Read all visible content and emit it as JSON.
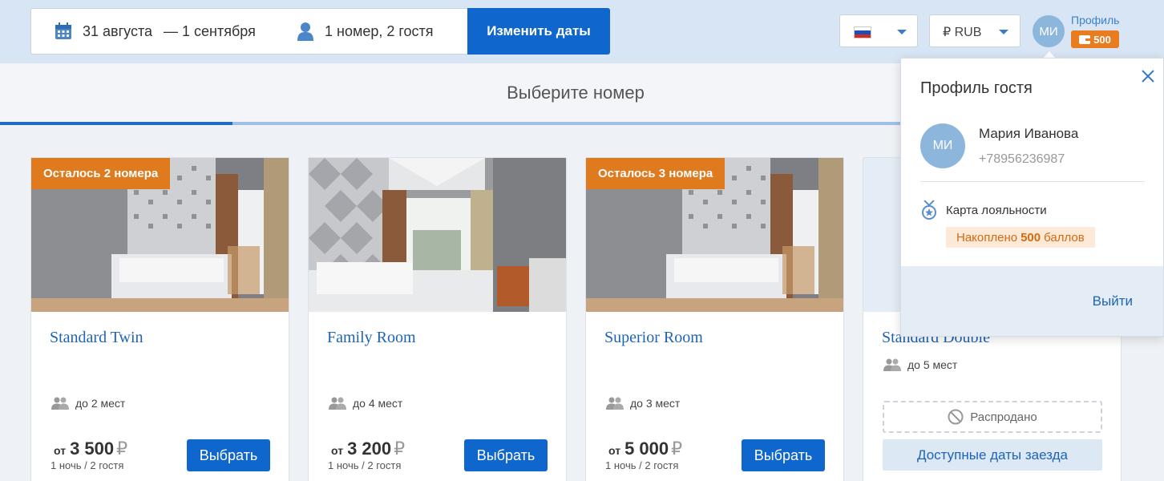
{
  "search": {
    "dates": "31 августа",
    "dates_end": "— 1 сентября",
    "guests": "1 номер, 2 гостя",
    "change_button": "Изменить даты"
  },
  "header": {
    "currency": "₽ RUB",
    "avatar_initials": "МИ",
    "profile_link": "Профиль",
    "points": "500"
  },
  "page": {
    "title": "Выберите номер",
    "progress": 0.2
  },
  "rooms": [
    {
      "badge": "Осталось 2 номера",
      "name": "Standard Twin",
      "capacity": "до 2 мест",
      "price_from": "от",
      "price": "3 500",
      "currency_symbol": "₽",
      "nights": "1 ночь / 2 гостя",
      "button": "Выбрать"
    },
    {
      "badge": "",
      "name": "Family Room",
      "capacity": "до 4 мест",
      "price_from": "от",
      "price": "3 200",
      "currency_symbol": "₽",
      "nights": "1 ночь / 2 гостя",
      "button": "Выбрать"
    },
    {
      "badge": "Осталось 3 номера",
      "name": "Superior Room",
      "capacity": "до 3 мест",
      "price_from": "от",
      "price": "5 000",
      "currency_symbol": "₽",
      "nights": "1 ночь / 2 гостя",
      "button": "Выбрать"
    },
    {
      "name": "Standard Double",
      "capacity": "до 5 мест",
      "status": "Распродано",
      "available_dates_button": "Доступные даты заезда"
    }
  ],
  "profile_popup": {
    "title": "Профиль гостя",
    "avatar_initials": "МИ",
    "name": "Мария Иванова",
    "phone": "+78956236987",
    "loyalty_label": "Карта лояльности",
    "accumulated_prefix": "Накоплено",
    "accumulated_points": "500",
    "accumulated_suffix": "баллов",
    "logout": "Выйти"
  },
  "colors": {
    "primary": "#0f66cc",
    "accent_orange": "#e07a1f",
    "topbar_bg": "#d8e5f4",
    "link": "#1e64b4"
  },
  "icons": {
    "calendar": "calendar-icon",
    "guest": "user-icon",
    "capacity": "people-icon",
    "sold_out": "prohibited-icon",
    "loyalty": "medal-icon",
    "wallet": "wallet-icon",
    "close": "close-icon"
  }
}
